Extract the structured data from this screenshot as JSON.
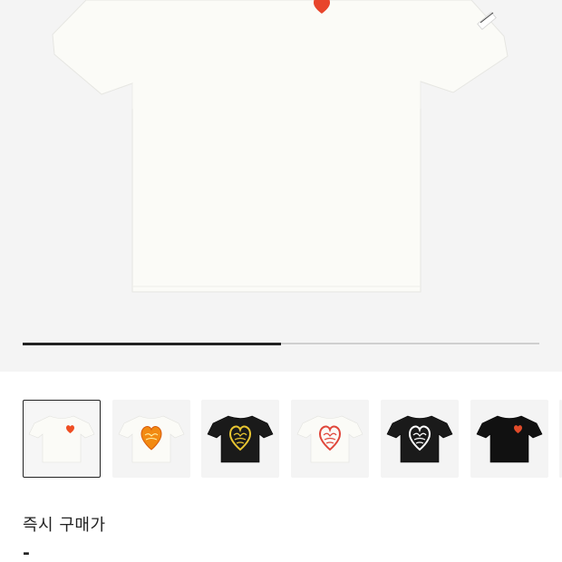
{
  "gallery": {
    "selected_index": 0,
    "progress_fraction": 0.5,
    "thumbnails": [
      {
        "name": "white-tee-small-red-heart",
        "shirt_color": "#fbfbf7",
        "print": "small-heart",
        "print_color": "#ef4e23"
      },
      {
        "name": "white-tee-orange-heart",
        "shirt_color": "#fbfbf7",
        "print": "big-heart",
        "print_color": "#f28a12"
      },
      {
        "name": "black-tee-yellow-heart",
        "shirt_color": "#1a1a1a",
        "print": "big-heart-outline",
        "print_color": "#e8c531"
      },
      {
        "name": "white-tee-red-heart",
        "shirt_color": "#fbfbf7",
        "print": "big-heart-outline",
        "print_color": "#e0473b"
      },
      {
        "name": "black-tee-white-heart",
        "shirt_color": "#1a1a1a",
        "print": "big-heart-outline",
        "print_color": "#ffffff"
      },
      {
        "name": "black-tee-small-heart",
        "shirt_color": "#111111",
        "print": "small-heart",
        "print_color": "#e14b2a"
      },
      {
        "name": "partial-thumbnail",
        "shirt_color": "#f4f4f4",
        "print": "none",
        "print_color": "#f4f4f4"
      }
    ]
  },
  "product": {
    "title": "즉시 구매가",
    "price": "-"
  },
  "colors": {
    "accent_heart": "#e8452c",
    "progress_track": "#cfcfcf",
    "progress_fill": "#222222"
  }
}
